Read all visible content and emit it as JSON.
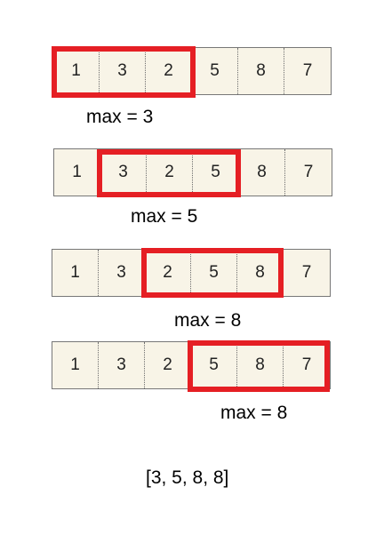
{
  "rows": [
    {
      "values": [
        "1",
        "3",
        "2",
        "5",
        "8",
        "7"
      ],
      "window_start": 0,
      "window_size": 3,
      "label": "max = 3"
    },
    {
      "values": [
        "1",
        "3",
        "2",
        "5",
        "8",
        "7"
      ],
      "window_start": 1,
      "window_size": 3,
      "label": "max = 5"
    },
    {
      "values": [
        "1",
        "3",
        "2",
        "5",
        "8",
        "7"
      ],
      "window_start": 2,
      "window_size": 3,
      "label": "max = 8"
    },
    {
      "values": [
        "1",
        "3",
        "2",
        "5",
        "8",
        "7"
      ],
      "window_start": 3,
      "window_size": 3,
      "label": "max = 8"
    }
  ],
  "result": "[3, 5, 8, 8]",
  "colors": {
    "cell_background": "#f8f4e7",
    "window_border": "#e51f24",
    "cell_border": "#777777"
  }
}
